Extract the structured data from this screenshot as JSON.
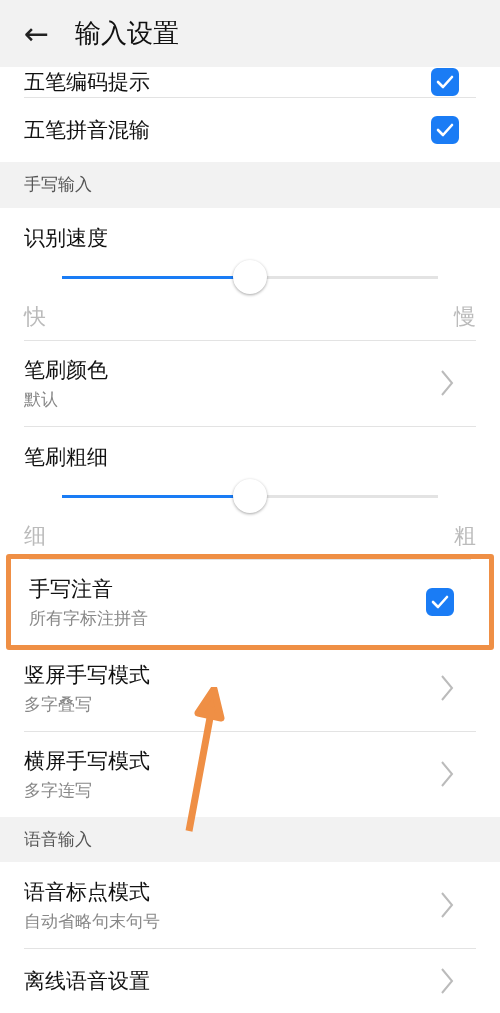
{
  "header": {
    "back": "←",
    "title": "输入设置"
  },
  "sections": [
    {
      "items": [
        {
          "kind": "check",
          "title": "五笔编码提示",
          "checked": true,
          "compact": true
        },
        {
          "kind": "check",
          "title": "五笔拼音混输",
          "checked": true
        }
      ]
    },
    {
      "title": "手写输入",
      "items": [
        {
          "kind": "slider",
          "title": "识别速度",
          "level": 0.5,
          "min_label": "快",
          "max_label": "慢"
        },
        {
          "kind": "nav",
          "title": "笔刷颜色",
          "subtitle": "默认"
        },
        {
          "kind": "slider",
          "title": "笔刷粗细",
          "level": 0.5,
          "min_label": "细",
          "max_label": "粗"
        },
        {
          "kind": "check",
          "title": "手写注音",
          "subtitle": "所有字标注拼音",
          "checked": true,
          "highlighted": true
        },
        {
          "kind": "nav",
          "title": "竖屏手写模式",
          "subtitle": "多字叠写"
        },
        {
          "kind": "nav",
          "title": "横屏手写模式",
          "subtitle": "多字连写"
        }
      ]
    },
    {
      "title": "语音输入",
      "items": [
        {
          "kind": "nav",
          "title": "语音标点模式",
          "subtitle": "自动省略句末句号"
        },
        {
          "kind": "nav",
          "title": "离线语音设置"
        }
      ]
    }
  ]
}
